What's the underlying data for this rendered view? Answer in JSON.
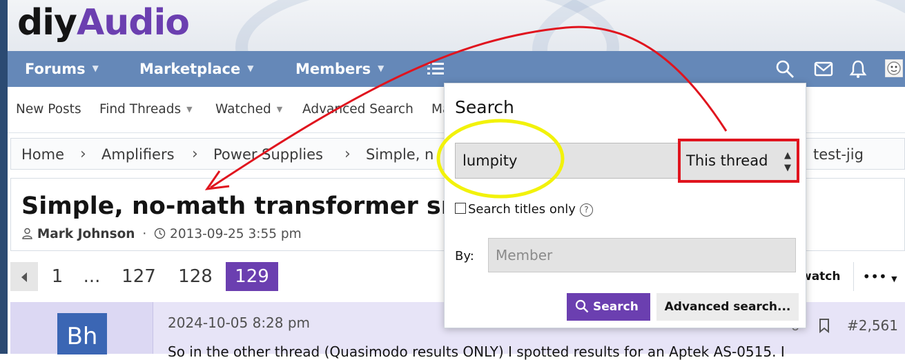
{
  "site": {
    "logo_part1": "diy",
    "logo_part2": "Audio"
  },
  "nav": {
    "tabs": [
      "Forums",
      "Marketplace",
      "Members"
    ],
    "icons": [
      "list-icon",
      "search-icon",
      "mail-icon",
      "bell-icon",
      "avatar"
    ]
  },
  "subnav": {
    "new_posts": "New Posts",
    "find_threads": "Find Threads",
    "watched": "Watched",
    "advanced_search": "Advanced Search",
    "partial": "Ma"
  },
  "breadcrumb": {
    "items": [
      "Home",
      "Amplifiers",
      "Power Supplies",
      "Simple, n",
      "test-jig"
    ]
  },
  "thread": {
    "title": "Simple, no-math transformer snubb",
    "author": "Mark Johnson",
    "dot": "·",
    "date": "2013-09-25 3:55 pm"
  },
  "pagination": {
    "pages": [
      "1",
      "...",
      "127",
      "128",
      "129"
    ],
    "current": "129"
  },
  "actions": {
    "watch": "watch",
    "more": "•••"
  },
  "post": {
    "avatar_initials": "Bh",
    "date": "2024-10-05 8:28 pm",
    "number": "#2,561",
    "likes_partial": "6",
    "snippet": "So in the other thread (Quasimodo results ONLY) I spotted results for an Aptek AS-0515. I"
  },
  "search_popup": {
    "title": "Search",
    "keyword_value": "lumpity",
    "scope_value": "This thread",
    "titles_only_label": "Search titles only",
    "help_glyph": "?",
    "by_label": "By:",
    "member_placeholder": "Member",
    "search_button": "Search",
    "advanced_button": "Advanced search..."
  },
  "colors": {
    "nav_bg": "#6588b8",
    "brand_purple": "#6b3fb0",
    "annotation_red": "#e0141e",
    "annotation_yellow": "#f2f20a"
  }
}
